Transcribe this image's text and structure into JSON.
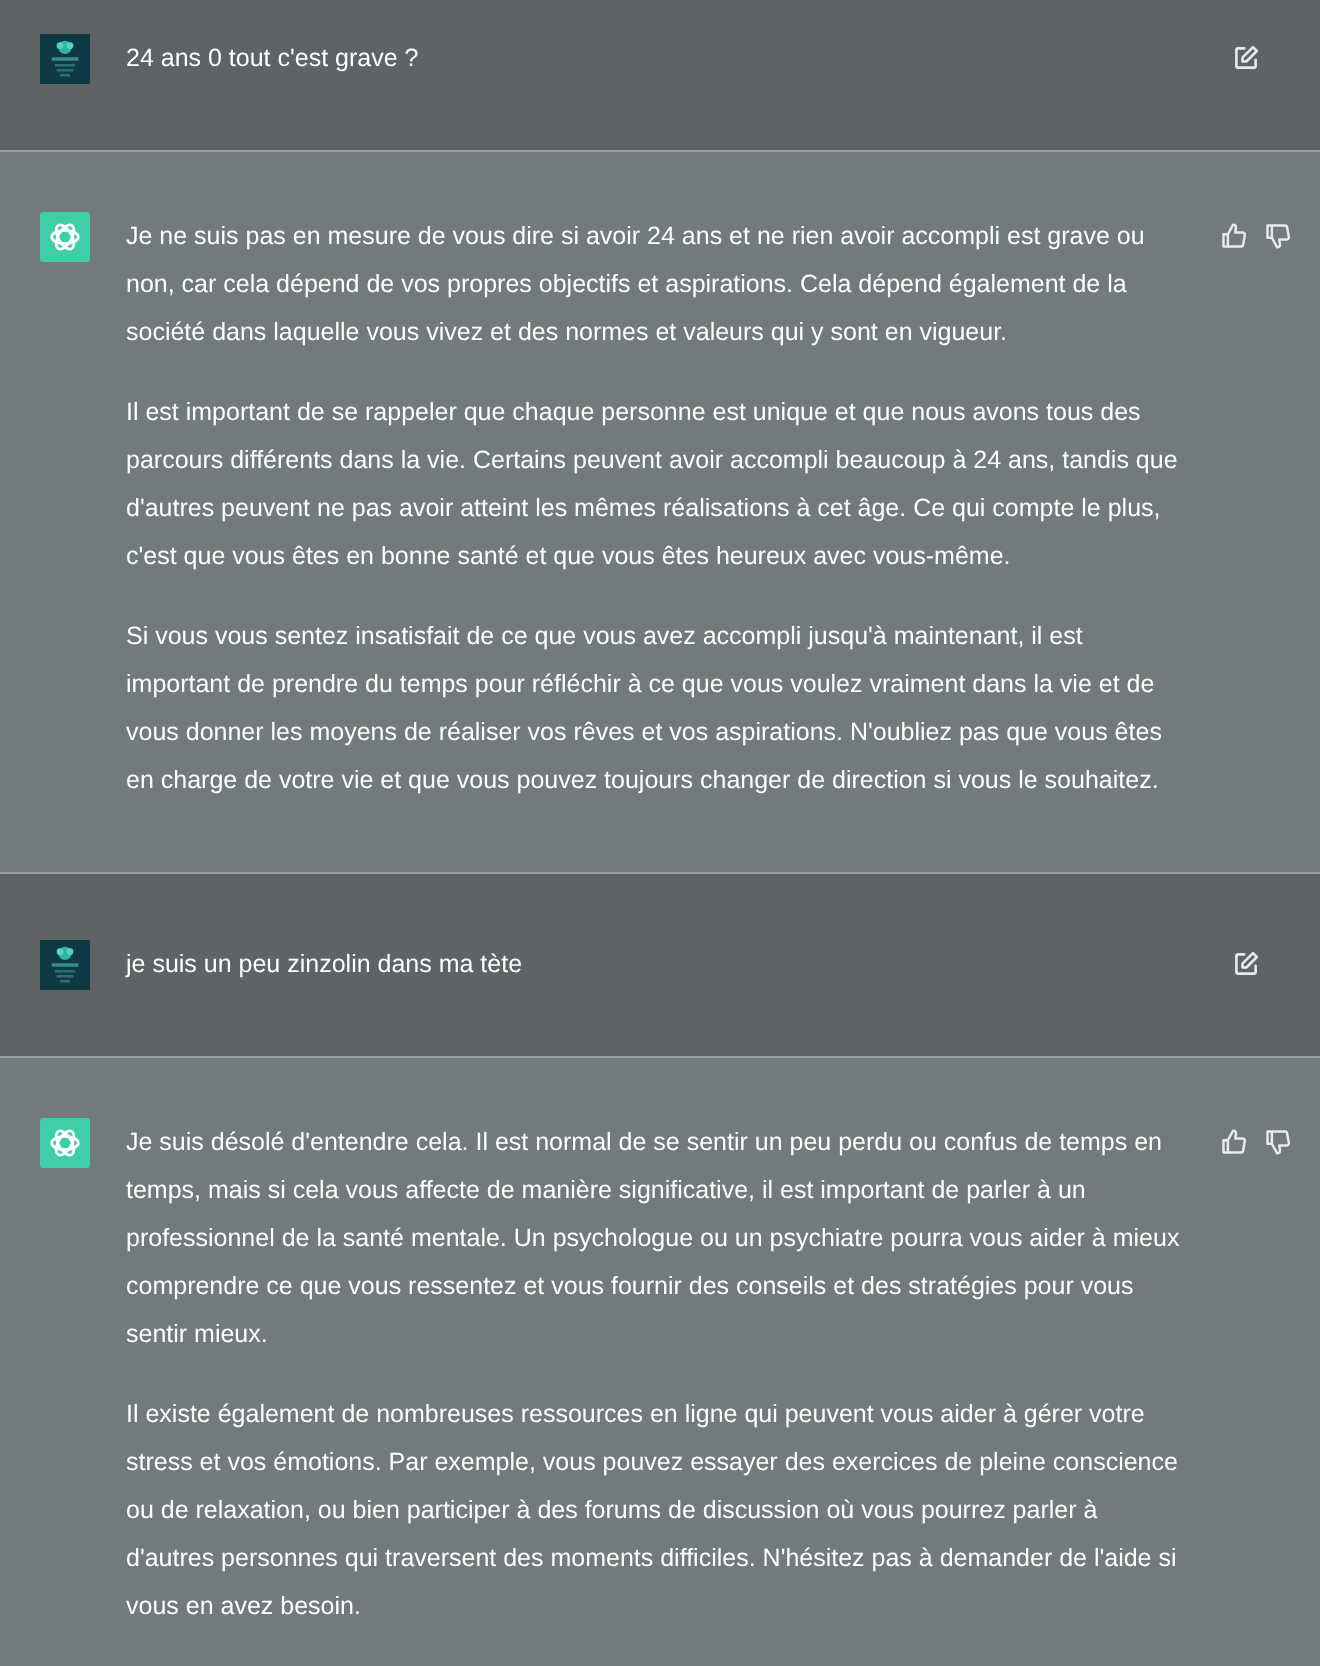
{
  "messages": [
    {
      "kind": "user",
      "text": "24 ans 0 tout c'est grave ?"
    },
    {
      "kind": "assistant",
      "paragraphs": [
        "Je ne suis pas en mesure de vous dire si avoir 24 ans et ne rien avoir accompli est grave ou non, car cela dépend de vos propres objectifs et aspirations. Cela dépend également de la société dans laquelle vous vivez et des normes et valeurs qui y sont en vigueur.",
        "Il est important de se rappeler que chaque personne est unique et que nous avons tous des parcours différents dans la vie. Certains peuvent avoir accompli beaucoup à 24 ans, tandis que d'autres peuvent ne pas avoir atteint les mêmes réalisations à cet âge. Ce qui compte le plus, c'est que vous êtes en bonne santé et que vous êtes heureux avec vous-même.",
        "Si vous vous sentez insatisfait de ce que vous avez accompli jusqu'à maintenant, il est important de prendre du temps pour réfléchir à ce que vous voulez vraiment dans la vie et de vous donner les moyens de réaliser vos rêves et vos aspirations. N'oubliez pas que vous êtes en charge de votre vie et que vous pouvez toujours changer de direction si vous le souhaitez."
      ]
    },
    {
      "kind": "user",
      "text": "je suis un peu zinzolin dans ma tète"
    },
    {
      "kind": "assistant",
      "paragraphs": [
        "Je suis désolé d'entendre cela. Il est normal de se sentir un peu perdu ou confus de temps en temps, mais si cela vous affecte de manière significative, il est important de parler à un professionnel de la santé mentale. Un psychologue ou un psychiatre pourra vous aider à mieux comprendre ce que vous ressentez et vous fournir des conseils et des stratégies pour vous sentir mieux.",
        "Il existe également de nombreuses ressources en ligne qui peuvent vous aider à gérer votre stress et vos émotions. Par exemple, vous pouvez essayer des exercices de pleine conscience ou de relaxation, ou bien participer à des forums de discussion où vous pourrez parler à d'autres personnes qui traversent des moments difficiles. N'hésitez pas à demander de l'aide si vous en avez besoin."
      ]
    }
  ]
}
